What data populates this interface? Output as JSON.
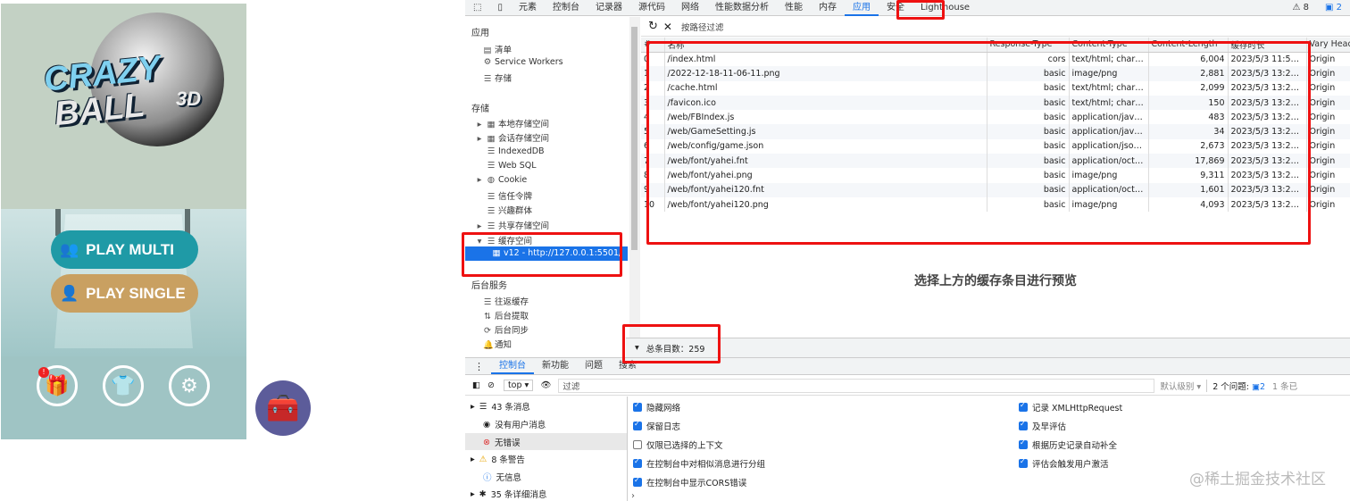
{
  "game": {
    "logo_line1": "CRAZY",
    "logo_line2": "BALL",
    "logo_3d": "3D",
    "play_multi": "PLAY MULTI",
    "play_single": "PLAY SINGLE",
    "gift_badge": "!"
  },
  "devtools": {
    "tabs": [
      "元素",
      "控制台",
      "记录器",
      "源代码",
      "网络",
      "性能数据分析",
      "性能",
      "内存",
      "应用",
      "安全",
      "Lighthouse"
    ],
    "active_tab": "应用",
    "badges": {
      "warnings": "8",
      "issues": "2"
    },
    "sidebar": {
      "app_header": "应用",
      "app_items": [
        "清单",
        "Service Workers",
        "存储"
      ],
      "storage_header": "存储",
      "storage_items": [
        "本地存储空间",
        "会话存储空间",
        "IndexedDB",
        "Web SQL",
        "Cookie",
        "信任令牌",
        "兴趣群体",
        "共享存储空间",
        "缓存空间"
      ],
      "cache_entry": "v12 - http://127.0.0.1:5501/",
      "bg_header": "后台服务",
      "bg_items": [
        "往返缓存",
        "后台提取",
        "后台同步",
        "通知"
      ]
    },
    "filter_placeholder": "按路径过滤",
    "columns": [
      "#",
      "名称",
      "Response-Type",
      "Content-Type",
      "Content-Length",
      "缓存时长",
      "Vary Header"
    ],
    "rows": [
      [
        "0",
        "/index.html",
        "cors",
        "text/html; charse...",
        "6,004",
        "2023/5/3 11:50:51",
        "Origin"
      ],
      [
        "1",
        "/2022-12-18-11-06-11.png",
        "basic",
        "image/png",
        "2,881",
        "2023/5/3 13:25:30",
        "Origin"
      ],
      [
        "2",
        "/cache.html",
        "basic",
        "text/html; charse...",
        "2,099",
        "2023/5/3 13:25:30",
        "Origin"
      ],
      [
        "3",
        "/favicon.ico",
        "basic",
        "text/html; charse...",
        "150",
        "2023/5/3 13:22:45",
        "Origin"
      ],
      [
        "4",
        "/web/FBIndex.js",
        "basic",
        "application/javas...",
        "483",
        "2023/5/3 13:21:35",
        "Origin"
      ],
      [
        "5",
        "/web/GameSetting.js",
        "basic",
        "application/javas...",
        "34",
        "2023/5/3 13:21:35",
        "Origin"
      ],
      [
        "6",
        "/web/config/game.json",
        "basic",
        "application/json; ...",
        "2,673",
        "2023/5/3 13:21:38",
        "Origin"
      ],
      [
        "7",
        "/web/font/yahei.fnt",
        "basic",
        "application/octet...",
        "17,869",
        "2023/5/3 13:21:37",
        "Origin"
      ],
      [
        "8",
        "/web/font/yahei.png",
        "basic",
        "image/png",
        "9,311",
        "2023/5/3 13:21:37",
        "Origin"
      ],
      [
        "9",
        "/web/font/yahei120.fnt",
        "basic",
        "application/octet...",
        "1,601",
        "2023/5/3 13:21:37",
        "Origin"
      ],
      [
        "10",
        "/web/font/yahei120.png",
        "basic",
        "image/png",
        "4,093",
        "2023/5/3 13:21:37",
        "Origin"
      ]
    ],
    "preview_text": "选择上方的缓存条目进行预览",
    "total_entries": "总条目数：259",
    "drawer_tabs": [
      "控制台",
      "新功能",
      "问题",
      "搜索"
    ],
    "console": {
      "context": "top",
      "filter_placeholder": "过滤",
      "level": "默认级别",
      "issues_label": "2 个问题:",
      "issues_count": "2",
      "hidden": "1 条已",
      "side": [
        "43 条消息",
        "没有用户消息",
        "无错误",
        "8 条警告",
        "无信息",
        "35 条详细消息"
      ],
      "options_left": [
        "隐藏网络",
        "保留日志",
        "仅限已选择的上下文",
        "在控制台中对相似消息进行分组",
        "在控制台中显示CORS错误"
      ],
      "options_left_checked": [
        true,
        true,
        false,
        true,
        true
      ],
      "options_right": [
        "记录 XMLHttpRequest",
        "及早评估",
        "根据历史记录自动补全",
        "评估会触发用户激活"
      ],
      "options_right_checked": [
        true,
        true,
        true,
        true
      ]
    }
  },
  "watermark": "@稀土掘金技术社区",
  "colors": {
    "accent": "#1a73e8",
    "highlight": "#e11111",
    "play_multi": "#1f9aa6",
    "play_single": "#c9a061"
  }
}
